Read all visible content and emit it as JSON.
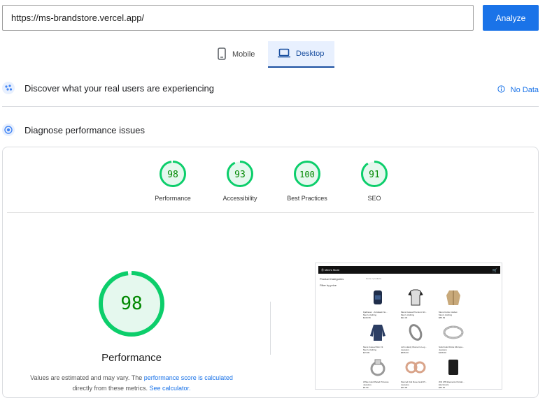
{
  "url_bar": {
    "value": "https://ms-brandstore.vercel.app/"
  },
  "analyze_label": "Analyze",
  "tabs": [
    {
      "label": "Mobile",
      "icon": "phone-icon",
      "selected": false
    },
    {
      "label": "Desktop",
      "icon": "laptop-icon",
      "selected": true
    }
  ],
  "field_section": {
    "title": "Discover what your real users are experiencing",
    "status": "No Data",
    "icon": "crux-icon"
  },
  "diagnose_section": {
    "title": "Diagnose performance issues",
    "icon": "lighthouse-icon"
  },
  "scores": [
    {
      "value": "98",
      "label": "Performance"
    },
    {
      "value": "93",
      "label": "Accessibility"
    },
    {
      "value": "100",
      "label": "Best Practices"
    },
    {
      "value": "91",
      "label": "SEO"
    }
  ],
  "main_score": {
    "value": "98",
    "title": "Performance",
    "note_before": "Values are estimated and may vary. The",
    "note_link1": "performance score is calculated",
    "note_middle": "directly from these metrics.",
    "note_link2": "See calculator."
  },
  "preview": {
    "header": "Ⓜ Men's Store",
    "sidebar": [
      "Product Categories",
      "Filter by price"
    ],
    "topbar": "Home / products",
    "products": [
      {
        "name": "Fjallraven - Foldsack No...",
        "category": "Men's clothing",
        "price": "$109.95"
      },
      {
        "name": "Mens Casual Premium Sli...",
        "category": "Men's clothing",
        "price": "$22.30"
      },
      {
        "name": "Mens Cotton Jacket",
        "category": "Men's clothing",
        "price": "$55.99"
      },
      {
        "name": "Mens Casual Slim Fit",
        "category": "Men's clothing",
        "price": "$15.99"
      },
      {
        "name": "John Hardy Women's Leg...",
        "category": "Jewelery",
        "price": "$695.00"
      },
      {
        "name": "Solid Gold Petite Micropa...",
        "category": "Jewelery",
        "price": "$168.00"
      },
      {
        "name": "White Gold Plated Princess",
        "category": "Jewelery",
        "price": "$9.99"
      },
      {
        "name": "Pierced Owl Rose Gold Pl...",
        "category": "Jewelery",
        "price": "$10.99"
      },
      {
        "name": "WD 2TB Elements Portab...",
        "category": "Electronics",
        "price": "$64.00"
      }
    ]
  },
  "colors": {
    "accent": "#1a73e8",
    "pass": "#0cce6b",
    "pass_bg": "#e5f8ee",
    "pass_text": "#008800"
  }
}
